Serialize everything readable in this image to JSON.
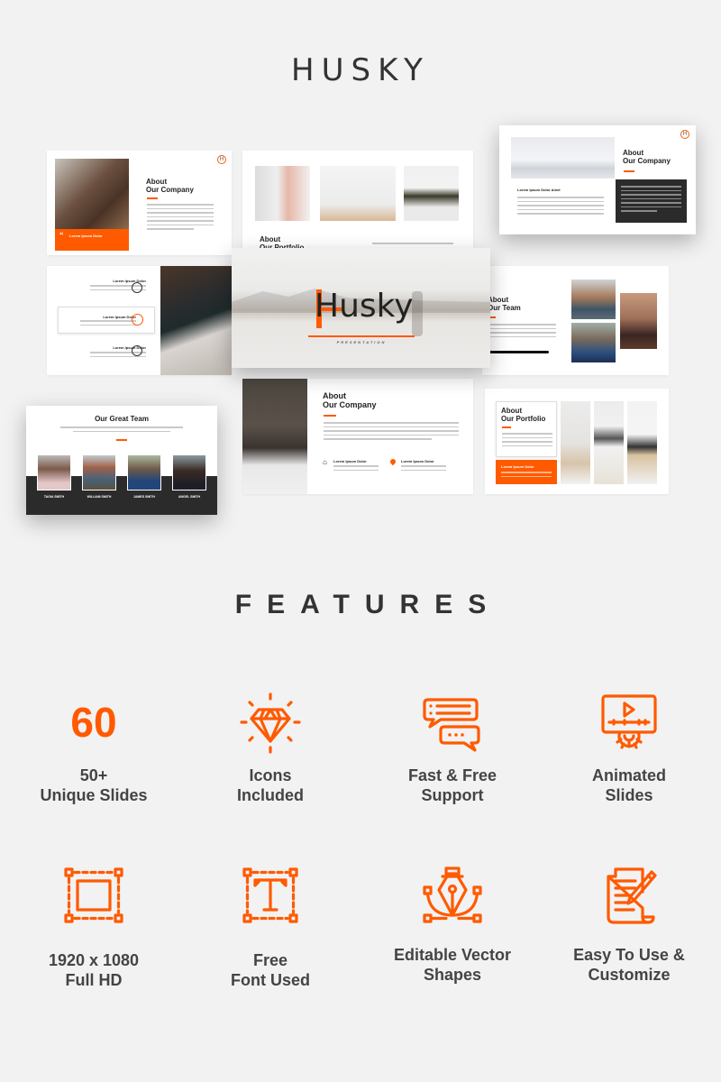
{
  "header": {
    "title": "HUSKY"
  },
  "colors": {
    "accent": "#ff5a00",
    "background": "#f2f2f2",
    "text": "#333333",
    "dark_panel": "#2b2b2b"
  },
  "slides": {
    "about_company_1": {
      "heading_line1": "About",
      "heading_line2": "Our Company",
      "quote_title": "Lorem Ipsum Dolor",
      "logo": "H"
    },
    "about_portfolio_top": {
      "heading_line1": "About",
      "heading_line2": "Our Portfolio"
    },
    "about_company_2": {
      "heading_line1": "About",
      "heading_line2": "Our Company",
      "subheading": "Lorem Ipsum Dolor Amet",
      "logo": "H"
    },
    "services": {
      "items": [
        {
          "title": "Lorem Ipsum Dolor"
        },
        {
          "title": "Lorem Ipsum Dolor"
        },
        {
          "title": "Lorem Ipsum Dolor"
        }
      ]
    },
    "cover": {
      "title": "Husky",
      "subtitle": "PRESENTATION"
    },
    "about_team": {
      "heading_line1": "About",
      "heading_line2": "Our Team"
    },
    "great_team": {
      "heading": "Our Great Team",
      "members": [
        {
          "name": "TAGIA SMITH"
        },
        {
          "name": "WILLIAM SMITH"
        },
        {
          "name": "JAMES SMITH"
        },
        {
          "name": "ANGEL SMITH"
        }
      ]
    },
    "about_company_3": {
      "heading_line1": "About",
      "heading_line2": "Our Company",
      "feature1": "Lorem Ipsum Dolor",
      "feature2": "Lorem Ipsum Dolor"
    },
    "about_portfolio_bottom": {
      "heading_line1": "About",
      "heading_line2": "Our Portfolio",
      "box_title": "Lorem Ipsum Dolor"
    }
  },
  "features": {
    "title": "FEATURES",
    "items": [
      {
        "icon": "number-60",
        "number": "60",
        "line1": "50+",
        "line2": "Unique Slides"
      },
      {
        "icon": "diamond-icon",
        "line1": "Icons",
        "line2": "Included"
      },
      {
        "icon": "chat-bubbles-icon",
        "line1": "Fast & Free",
        "line2": "Support"
      },
      {
        "icon": "video-gear-icon",
        "line1": "Animated",
        "line2": "Slides"
      },
      {
        "icon": "resize-frame-icon",
        "line1": "1920 x 1080",
        "line2": "Full HD"
      },
      {
        "icon": "font-frame-icon",
        "line1": "Free",
        "line2": "Font Used"
      },
      {
        "icon": "pen-tool-icon",
        "line1": "Editable Vector",
        "line2": "Shapes"
      },
      {
        "icon": "document-edit-icon",
        "line1": "Easy To Use &",
        "line2": "Customize"
      }
    ]
  }
}
